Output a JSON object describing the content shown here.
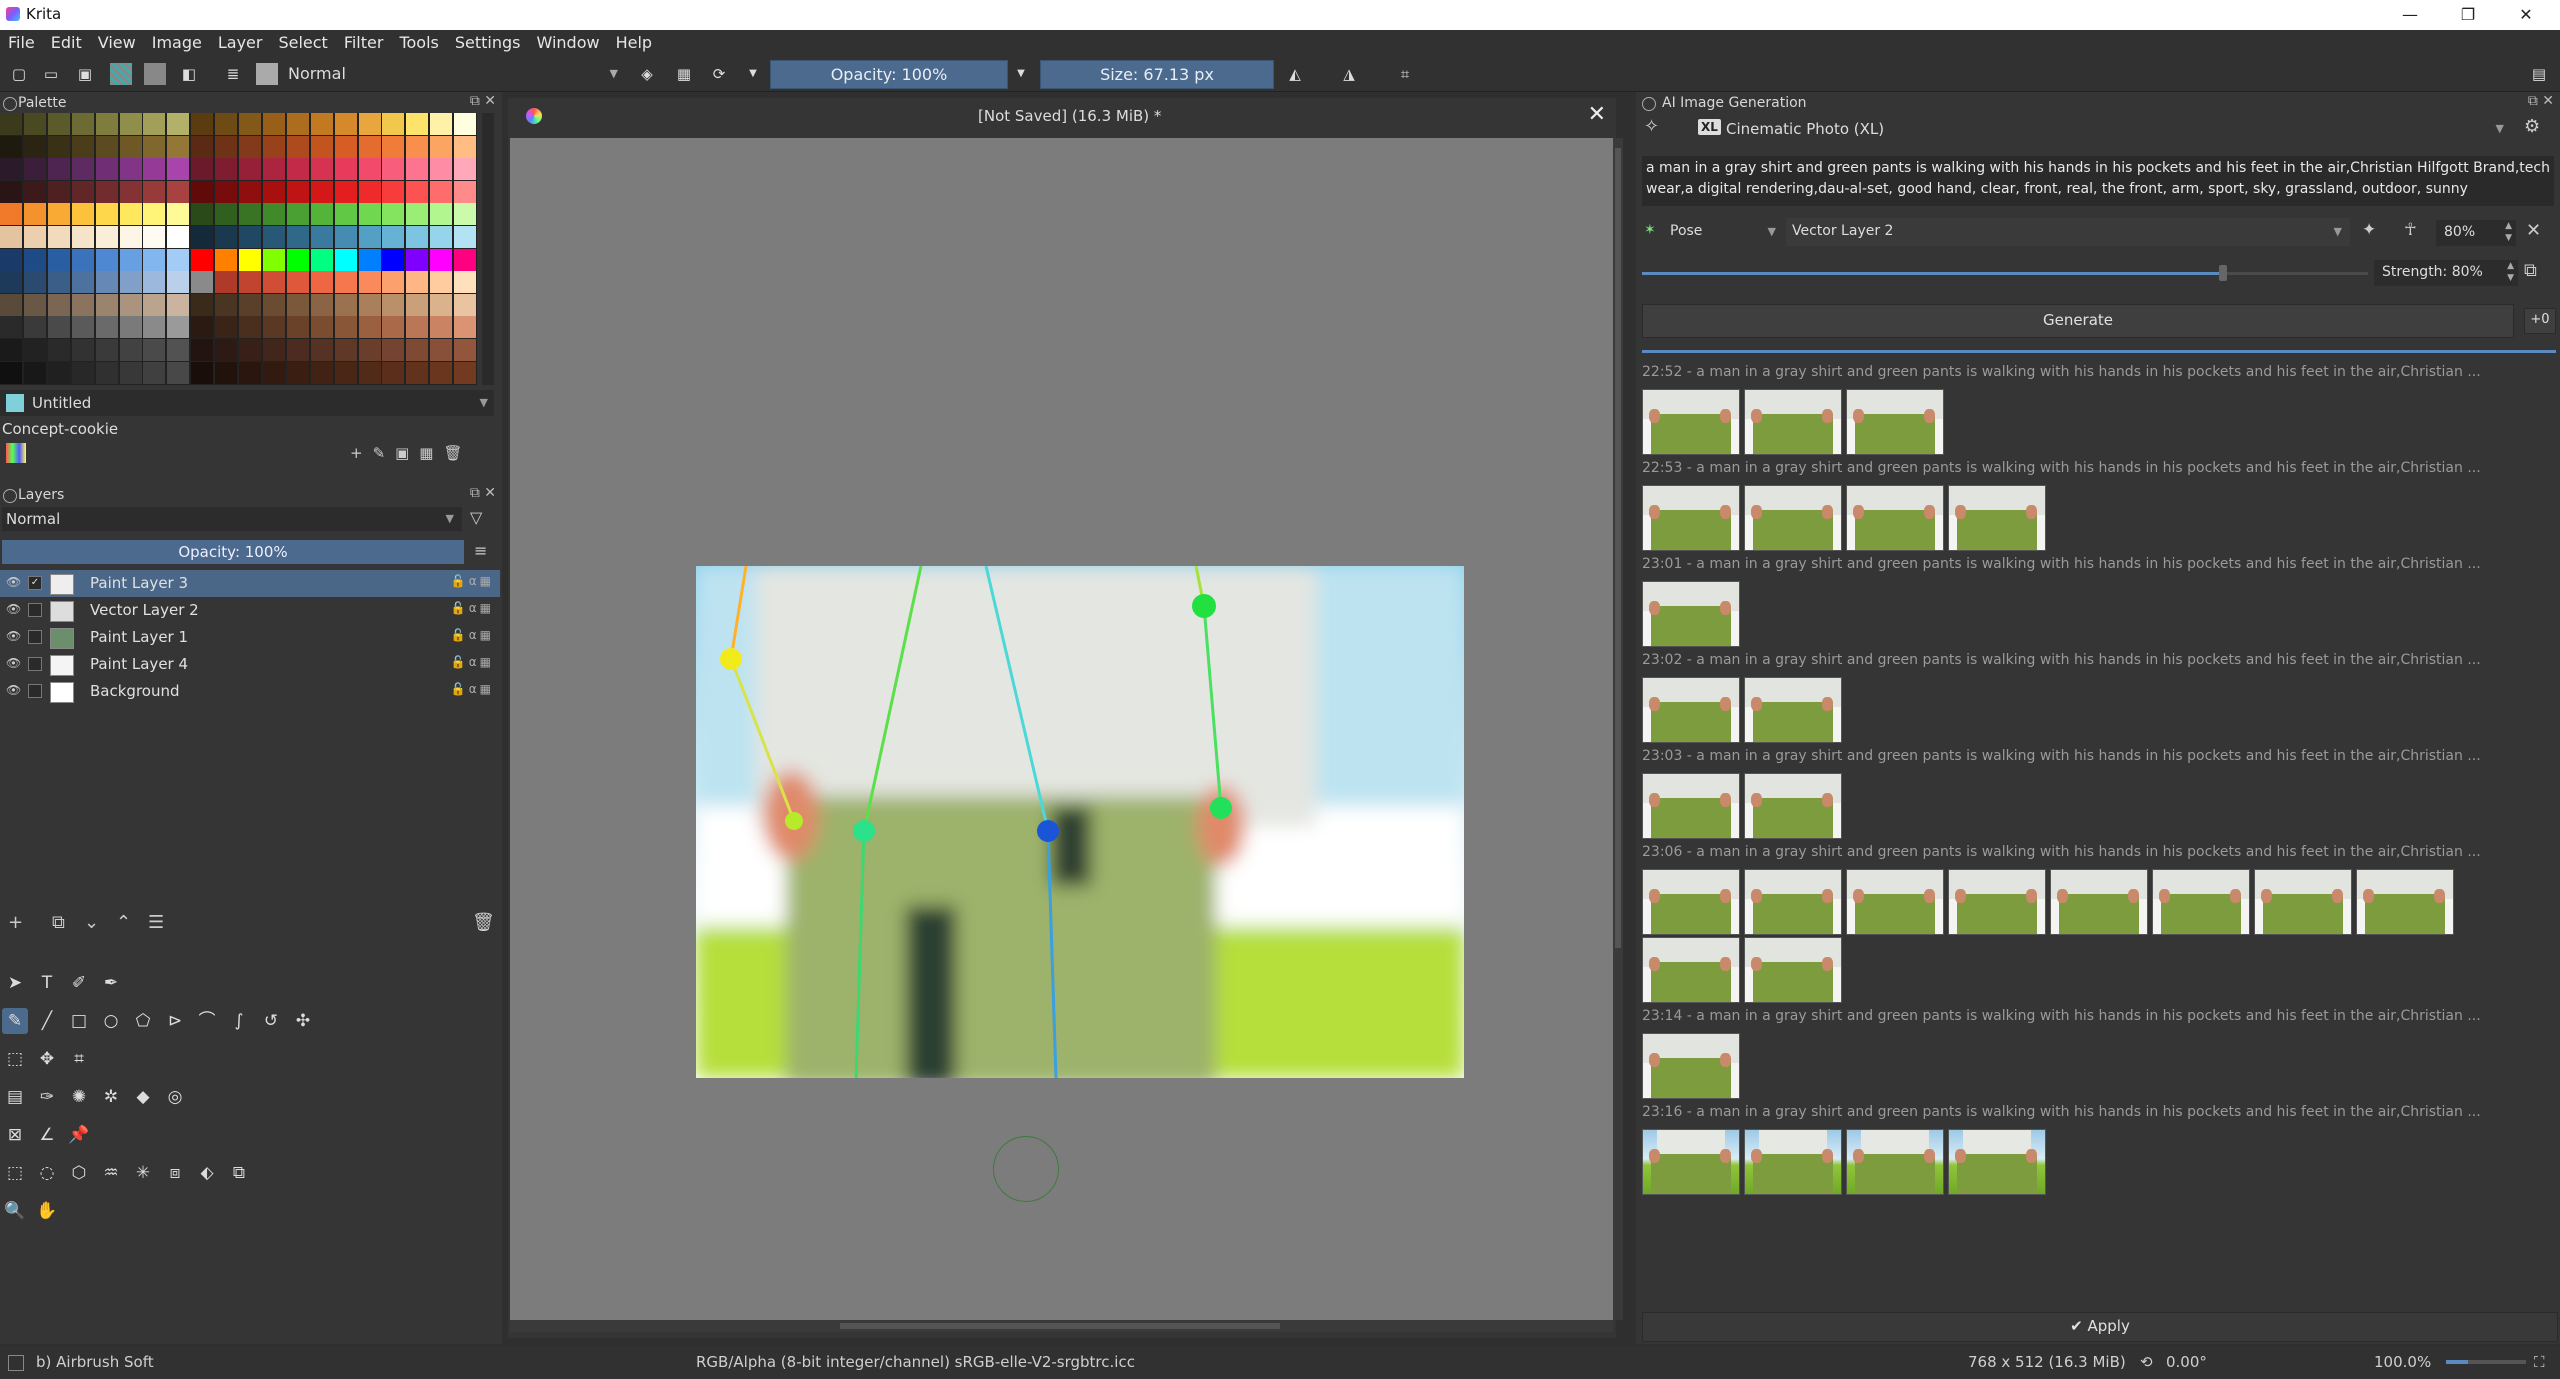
{
  "window": {
    "title": "Krita",
    "minimize": "—",
    "maximize": "❐",
    "close": "✕"
  },
  "menu": [
    "File",
    "Edit",
    "View",
    "Image",
    "Layer",
    "Select",
    "Filter",
    "Tools",
    "Settings",
    "Window",
    "Help"
  ],
  "toolbar": {
    "blend_mode": "Normal",
    "opacity": "Opacity: 100%",
    "size": "Size: 67.13 px"
  },
  "palette": {
    "title": "Palette",
    "palette_name": "Untitled",
    "resource_name": "Concept-cookie",
    "colors": [
      [
        "#3c3a1c",
        "#4a4a22",
        "#5a5a2a",
        "#6b6b33",
        "#7e7d3e",
        "#8f8e4a",
        "#a2a058",
        "#b3b06a",
        "#5a3c10",
        "#6e4a14",
        "#83591a",
        "#985f18",
        "#ad6d1e",
        "#c17a22",
        "#d6892a",
        "#e8a63e",
        "#f2c84c",
        "#fde36a",
        "#fff1a8",
        "#ffffe0"
      ],
      [
        "#1e1a0e",
        "#2c2412",
        "#3a3016",
        "#4b3c1a",
        "#5c4a20",
        "#6e5826",
        "#80672d",
        "#927736",
        "#5a2a14",
        "#6e3216",
        "#833a1a",
        "#98421c",
        "#ad4a1e",
        "#c25420",
        "#d65e24",
        "#e46c2e",
        "#f07c3a",
        "#f88f4c",
        "#fca462",
        "#ffbd84"
      ],
      [
        "#2a1a2a",
        "#3a1e3a",
        "#4e2450",
        "#5e2a62",
        "#702e74",
        "#823486",
        "#963a98",
        "#a844ac",
        "#6a1a2a",
        "#801c30",
        "#962038",
        "#ac2440",
        "#c22a48",
        "#d63252",
        "#e83a5a",
        "#f24a6a",
        "#f85e7c",
        "#fc7490",
        "#fe8ca4",
        "#ffa8ba"
      ],
      [
        "#2a1416",
        "#3c1a1c",
        "#4e2022",
        "#602628",
        "#722c2e",
        "#843234",
        "#963a3a",
        "#a84240",
        "#600a0a",
        "#780c0c",
        "#900e0e",
        "#a81010",
        "#c01414",
        "#d41818",
        "#e41e1e",
        "#f02a2a",
        "#f83c3c",
        "#fc5252",
        "#fe6c6c",
        "#ff8a8a"
      ],
      [
        "#f07a2a",
        "#f4922e",
        "#f8aa34",
        "#fcc23c",
        "#fed84a",
        "#ffe85e",
        "#fff478",
        "#fffa98",
        "#2a4a1a",
        "#30601e",
        "#387424",
        "#408a2a",
        "#4aa032",
        "#54b43a",
        "#60c844",
        "#70d850",
        "#84e460",
        "#9aee76",
        "#b2f690",
        "#cafaaa"
      ],
      [
        "#e4c4a0",
        "#eccfae",
        "#f2dabc",
        "#f6e4ca",
        "#faeed8",
        "#fdf6e6",
        "#fffbf2",
        "#ffffff",
        "#142a3a",
        "#1a384e",
        "#204862",
        "#285876",
        "#30688a",
        "#3a7a9e",
        "#468cb2",
        "#54a0c4",
        "#66b2d4",
        "#7cc4e2",
        "#96d4ec",
        "#b2e2f4"
      ],
      [
        "#1a3a6a",
        "#1e4a86",
        "#2a5ea2",
        "#3a72bc",
        "#4e88d2",
        "#66a0e2",
        "#82b6ee",
        "#a2ccf6",
        "#ff0000",
        "#ff8000",
        "#ffff00",
        "#80ff00",
        "#00ff00",
        "#00ff80",
        "#00ffff",
        "#0080ff",
        "#0000ff",
        "#8000ff",
        "#ff00ff",
        "#ff0080"
      ],
      [
        "#1e3a5a",
        "#2a4a70",
        "#3a5e88",
        "#4e72a0",
        "#6688b6",
        "#80a0ca",
        "#9cb8dc",
        "#bad0ea",
        "#8a8a8a",
        "#b03a2a",
        "#c04430",
        "#d04e36",
        "#e0583c",
        "#ee6644",
        "#f6764e",
        "#fa8a5c",
        "#fca06e",
        "#feb684",
        "#fecc9e",
        "#fee0bc"
      ],
      [
        "#5a4a3a",
        "#6a5846",
        "#7a6652",
        "#8a7460",
        "#9a846e",
        "#aa947e",
        "#baa48e",
        "#cab4a0",
        "#3a2a1a",
        "#4a3422",
        "#5a402a",
        "#6a4c32",
        "#7a583a",
        "#8a6444",
        "#9a7250",
        "#aa805c",
        "#ba906a",
        "#caa07a",
        "#dab28c",
        "#eac4a0"
      ],
      [
        "#2a2a2a",
        "#3a3a3a",
        "#4a4a4a",
        "#5a5a5a",
        "#6a6a6a",
        "#7a7a7a",
        "#8a8a8a",
        "#9a9a9a",
        "#2a1a12",
        "#3a2418",
        "#4a2e1e",
        "#5a3824",
        "#6a422a",
        "#7a4c30",
        "#8a5638",
        "#9a6040",
        "#aa6a4a",
        "#ba7656",
        "#ca8464",
        "#da9474"
      ],
      [
        "#1a1a1a",
        "#222222",
        "#2a2a2a",
        "#323232",
        "#3a3a3a",
        "#424242",
        "#4a4a4a",
        "#525252",
        "#241410",
        "#2e1a14",
        "#382018",
        "#42261c",
        "#4c2c20",
        "#563224",
        "#603828",
        "#6a3e2c",
        "#744430",
        "#7e4a34",
        "#885038",
        "#92563c"
      ],
      [
        "#101010",
        "#181818",
        "#202020",
        "#282828",
        "#303030",
        "#383838",
        "#404040",
        "#484848",
        "#1a0e0a",
        "#22120c",
        "#2a160e",
        "#321a10",
        "#3a1e12",
        "#422214",
        "#4a2616",
        "#522a18",
        "#5a2e1a",
        "#62321c",
        "#6a361e",
        "#723a20"
      ]
    ]
  },
  "layers": {
    "title": "Layers",
    "blend_mode": "Normal",
    "opacity": "Opacity:  100%",
    "items": [
      {
        "name": "Paint Layer 3",
        "selected": true
      },
      {
        "name": "Vector Layer 2",
        "selected": false
      },
      {
        "name": "Paint Layer 1",
        "selected": false
      },
      {
        "name": "Paint Layer 4",
        "selected": false
      },
      {
        "name": "Background",
        "selected": false
      }
    ]
  },
  "document": {
    "tab_title": "[Not Saved]  (16.3 MiB) *"
  },
  "ai": {
    "title": "AI Image Generation",
    "model": "Cinematic Photo (XL)",
    "model_badge": "XL",
    "prompt": "a man in a gray shirt and green pants is walking with his hands in his pockets and his feet in the air,Christian Hilfgott Brand,tech wear,a digital rendering,dau-al-set, good hand, clear, front, real, the front, arm, sport, sky, grassland, outdoor, sunny",
    "control_type": "Pose",
    "control_layer": "Vector Layer 2",
    "control_strength": "80%",
    "control_strength_fraction": 0.8,
    "strength": "Strength: 80%",
    "generate": "Generate",
    "queue_badge": "+0",
    "apply": "Apply",
    "history": [
      {
        "header": "22:52 - a man in a gray shirt and green pants is walking with his hands in his pockets and his feet in the air,Christian ...",
        "count": 3
      },
      {
        "header": "22:53 - a man in a gray shirt and green pants is walking with his hands in his pockets and his feet in the air,Christian ...",
        "count": 4
      },
      {
        "header": "23:01 - a man in a gray shirt and green pants is walking with his hands in his pockets and his feet in the air,Christian ...",
        "count": 1
      },
      {
        "header": "23:02 - a man in a gray shirt and green pants is walking with his hands in his pockets and his feet in the air,Christian ...",
        "count": 2
      },
      {
        "header": "23:03 - a man in a gray shirt and green pants is walking with his hands in his pockets and his feet in the air,Christian ...",
        "count": 2
      },
      {
        "header": "23:06 - a man in a gray shirt and green pants is walking with his hands in his pockets and his feet in the air,Christian ...",
        "count": 10
      },
      {
        "header": "23:14 - a man in a gray shirt and green pants is walking with his hands in his pockets and his feet in the air,Christian ...",
        "count": 1
      },
      {
        "header": "23:16 - a man in a gray shirt and green pants is walking with his hands in his pockets and his feet in the air,Christian ...",
        "count": 4
      }
    ]
  },
  "status": {
    "brush": "b) Airbrush Soft",
    "color_space": "RGB/Alpha (8-bit integer/channel)  sRGB-elle-V2-srgbtrc.icc",
    "dimensions": "768 x 512 (16.3 MiB)",
    "rotation": "0.00°",
    "zoom": "100.0%"
  },
  "icons": {
    "new": "new-document-icon",
    "open": "open-icon",
    "save": "save-icon",
    "eraser": "eraser-icon",
    "mirror": "mirror-icon",
    "wrap": "wrap-icon"
  }
}
